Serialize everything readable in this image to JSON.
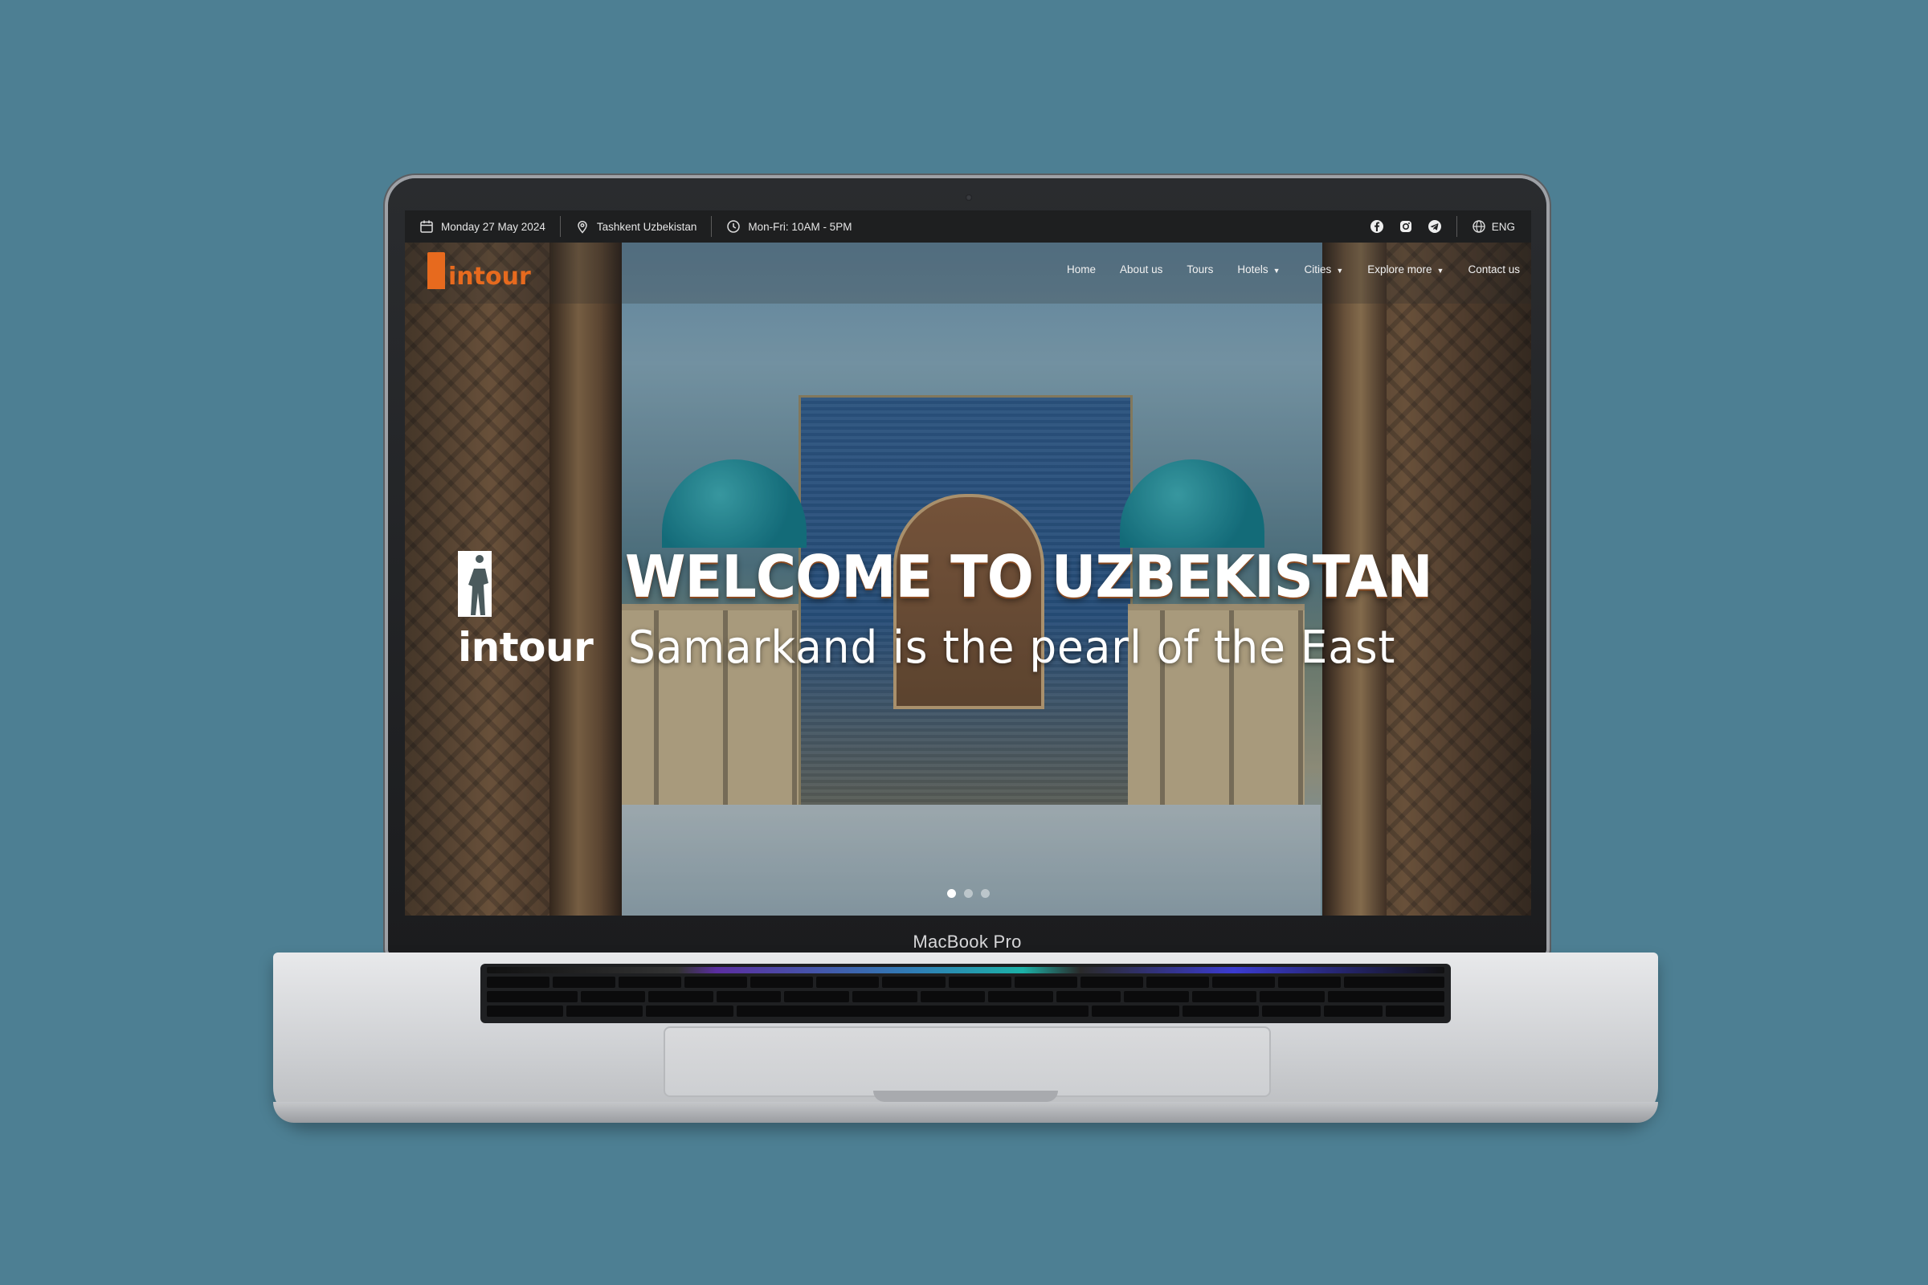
{
  "device": {
    "label": "MacBook Pro"
  },
  "topbar": {
    "date": "Monday 27 May 2024",
    "location": "Tashkent Uzbekistan",
    "hours": "Mon-Fri: 10AM - 5PM",
    "social_icons": [
      "facebook-icon",
      "instagram-icon",
      "telegram-icon"
    ],
    "language": "ENG"
  },
  "nav": {
    "logo_text": "intour",
    "items": [
      {
        "label": "Home",
        "has_dropdown": false
      },
      {
        "label": "About us",
        "has_dropdown": false
      },
      {
        "label": "Tours",
        "has_dropdown": false
      },
      {
        "label": "Hotels",
        "has_dropdown": true
      },
      {
        "label": "Cities",
        "has_dropdown": true
      },
      {
        "label": "Explore more",
        "has_dropdown": true
      },
      {
        "label": "Contact us",
        "has_dropdown": false
      }
    ]
  },
  "hero": {
    "brand_word": "intour",
    "title": "WELCOME TO UZBEKISTAN",
    "subtitle": "Samarkand is the pearl of the East",
    "slide_count": 3,
    "active_slide": 1
  },
  "colors": {
    "brand_orange": "#e76a1e",
    "background": "#4d7f93",
    "topbar_bg": "#1e1f20"
  }
}
